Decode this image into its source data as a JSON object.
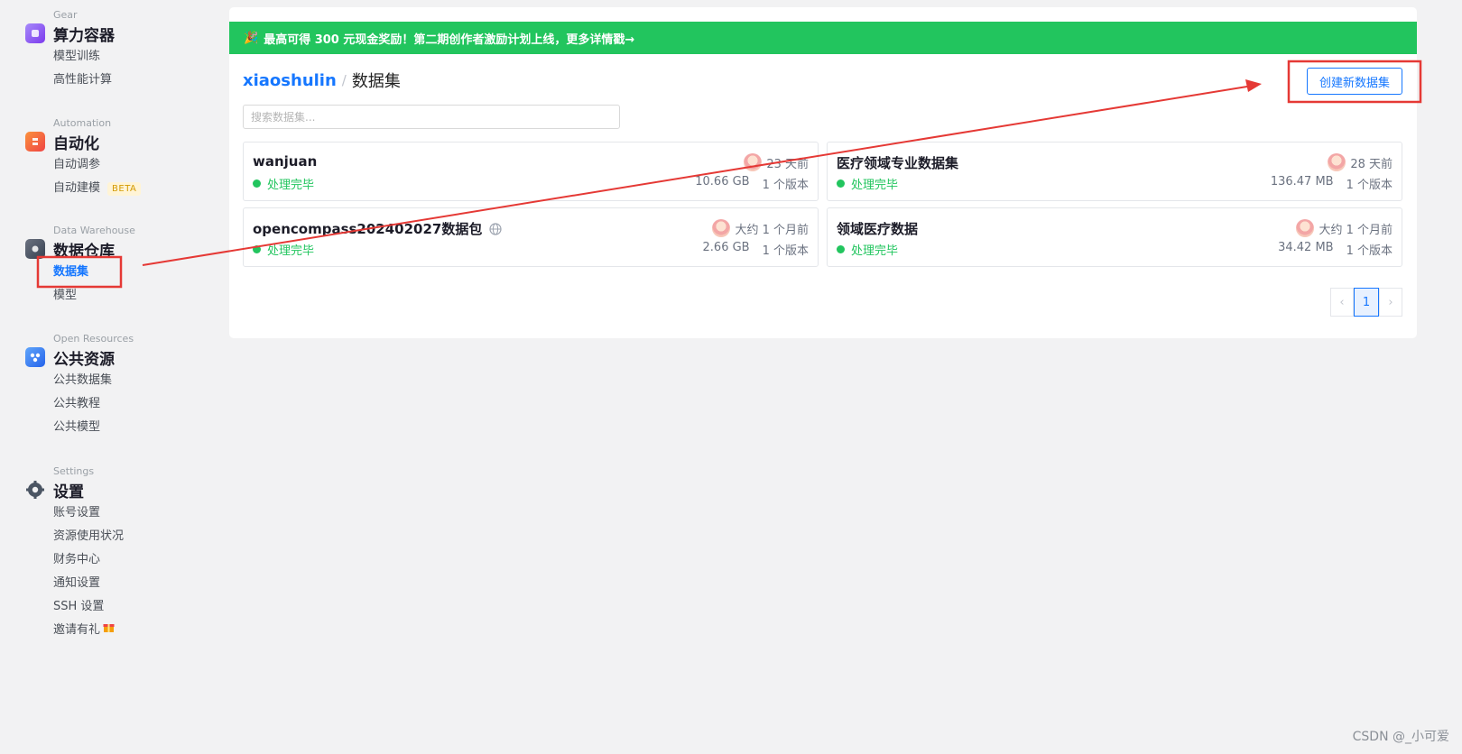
{
  "sidebar": {
    "groups": [
      {
        "sub": "Gear",
        "title": "算力容器",
        "items": [
          "模型训练",
          "高性能计算"
        ]
      },
      {
        "sub": "Automation",
        "title": "自动化",
        "items": [
          "自动调参",
          "自动建模"
        ],
        "beta": "BETA"
      },
      {
        "sub": "Data Warehouse",
        "title": "数据仓库",
        "items": [
          "数据集",
          "模型"
        ]
      },
      {
        "sub": "Open Resources",
        "title": "公共资源",
        "items": [
          "公共数据集",
          "公共教程",
          "公共模型"
        ]
      },
      {
        "sub": "Settings",
        "title": "设置",
        "items": [
          "账号设置",
          "资源使用状况",
          "财务中心",
          "通知设置",
          "SSH 设置",
          "邀请有礼"
        ]
      }
    ]
  },
  "banner": {
    "text": "最高可得 300 元现金奖励！第二期创作者激励计划上线，更多详情戳→",
    "icon": "party-icon"
  },
  "breadcrumb": {
    "user": "xiaoshulin",
    "sep": "/",
    "page": "数据集"
  },
  "create_button": "创建新数据集",
  "search": {
    "placeholder": "搜索数据集...",
    "value": ""
  },
  "datasets": [
    {
      "name": "wanjuan",
      "status": "处理完毕",
      "time": "23 天前",
      "size": "10.66 GB",
      "versions": "1 个版本",
      "public": false
    },
    {
      "name": "医疗领域专业数据集",
      "status": "处理完毕",
      "time": "28 天前",
      "size": "136.47 MB",
      "versions": "1 个版本",
      "public": false
    },
    {
      "name": "opencompass20240202​7数据包",
      "status": "处理完毕",
      "time": "大约 1 个月前",
      "size": "2.66 GB",
      "versions": "1 个版本",
      "public": true
    },
    {
      "name": "领域医疗数据",
      "status": "处理完毕",
      "time": "大约 1 个月前",
      "size": "34.42 MB",
      "versions": "1 个版本",
      "public": false
    }
  ],
  "pagination": {
    "prev": "‹",
    "current": "1",
    "next": "›"
  },
  "watermark": "CSDN @_小可爱",
  "colors": {
    "accent": "#1677ff",
    "success": "#22c55e",
    "annotation": "#e53935"
  }
}
